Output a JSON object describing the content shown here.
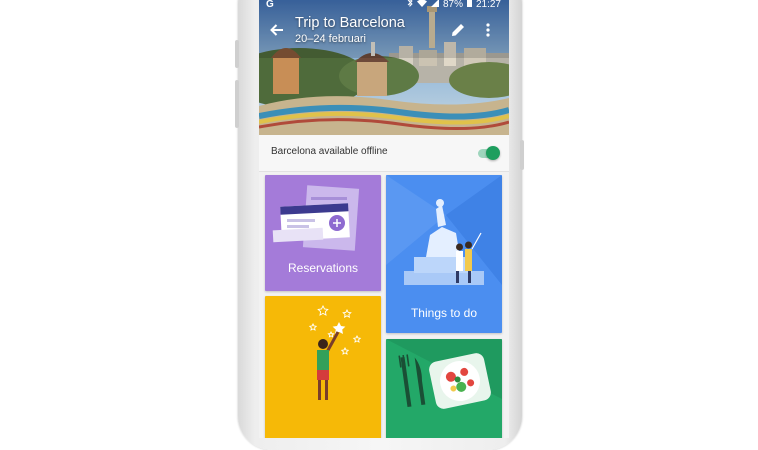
{
  "statusbar": {
    "app_icon": "G",
    "battery_text": "87%",
    "time": "21:27",
    "icons": [
      "bluetooth-icon",
      "wifi-icon",
      "signal-icon",
      "battery-icon"
    ]
  },
  "appbar": {
    "title": "Trip to Barcelona",
    "dates": "20–24 februari",
    "icons": [
      "back-arrow-icon",
      "pencil-icon",
      "more-vert-icon"
    ]
  },
  "offline": {
    "label": "Barcelona available offline",
    "enabled": true
  },
  "cards": {
    "reservations": "Reservations",
    "things_to_do": "Things to do"
  },
  "colors": {
    "accent_green": "#1e9e5e",
    "reservations": "#a47bd9",
    "things_to_do": "#4b8ef0",
    "yellow_card": "#f6b907",
    "green_card": "#23a868"
  }
}
